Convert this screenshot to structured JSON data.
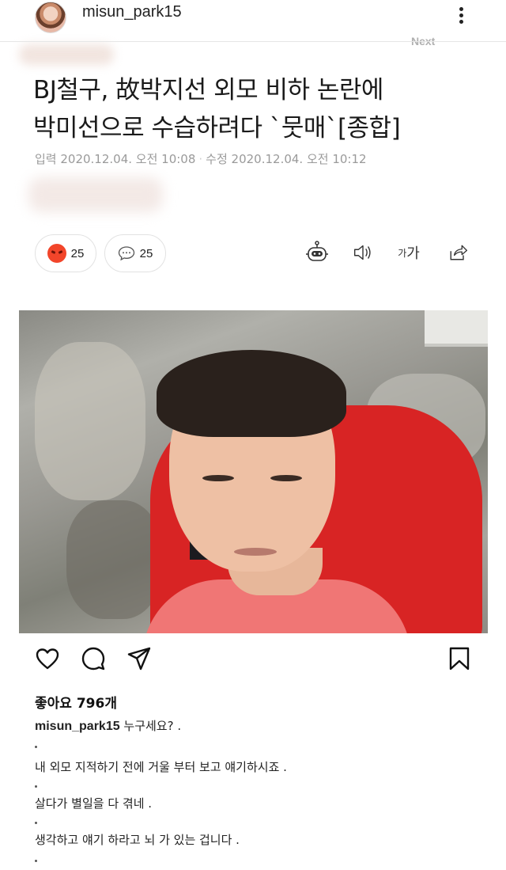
{
  "post": {
    "username": "misun_park15",
    "likes_label": "좋아요 796개",
    "caption_user": "misun_park15",
    "caption_lines": [
      "누구세요? .",
      "내 외모 지적하기 전에 거울 부터 보고 얘기하시죠 .",
      "살다가 별일을 다 겪네 .",
      "생각하고 얘기 하라고 뇌 가 있는 겁니다 ."
    ],
    "icons": {
      "more": "more-vertical-icon",
      "like": "heart-icon",
      "comment": "comment-icon",
      "share": "send-icon",
      "save": "bookmark-icon"
    }
  },
  "article": {
    "faded_corner_text": "Next",
    "headline_line1": "BJ철구, 故박지선 외모 비하 논란에",
    "headline_line2": "박미선으로 수습하려다 `뭇매`[종합]",
    "meta_input": "입력 2020.12.04. 오전 10:08",
    "meta_edit": "수정 2020.12.04. 오전 10:12",
    "reaction_count": "25",
    "comment_count": "25",
    "font_small": "가",
    "font_big": "가",
    "tools": [
      "robot-icon",
      "speaker-icon",
      "font-size-icon",
      "share-icon"
    ],
    "reaction_color": "#f2452a"
  }
}
